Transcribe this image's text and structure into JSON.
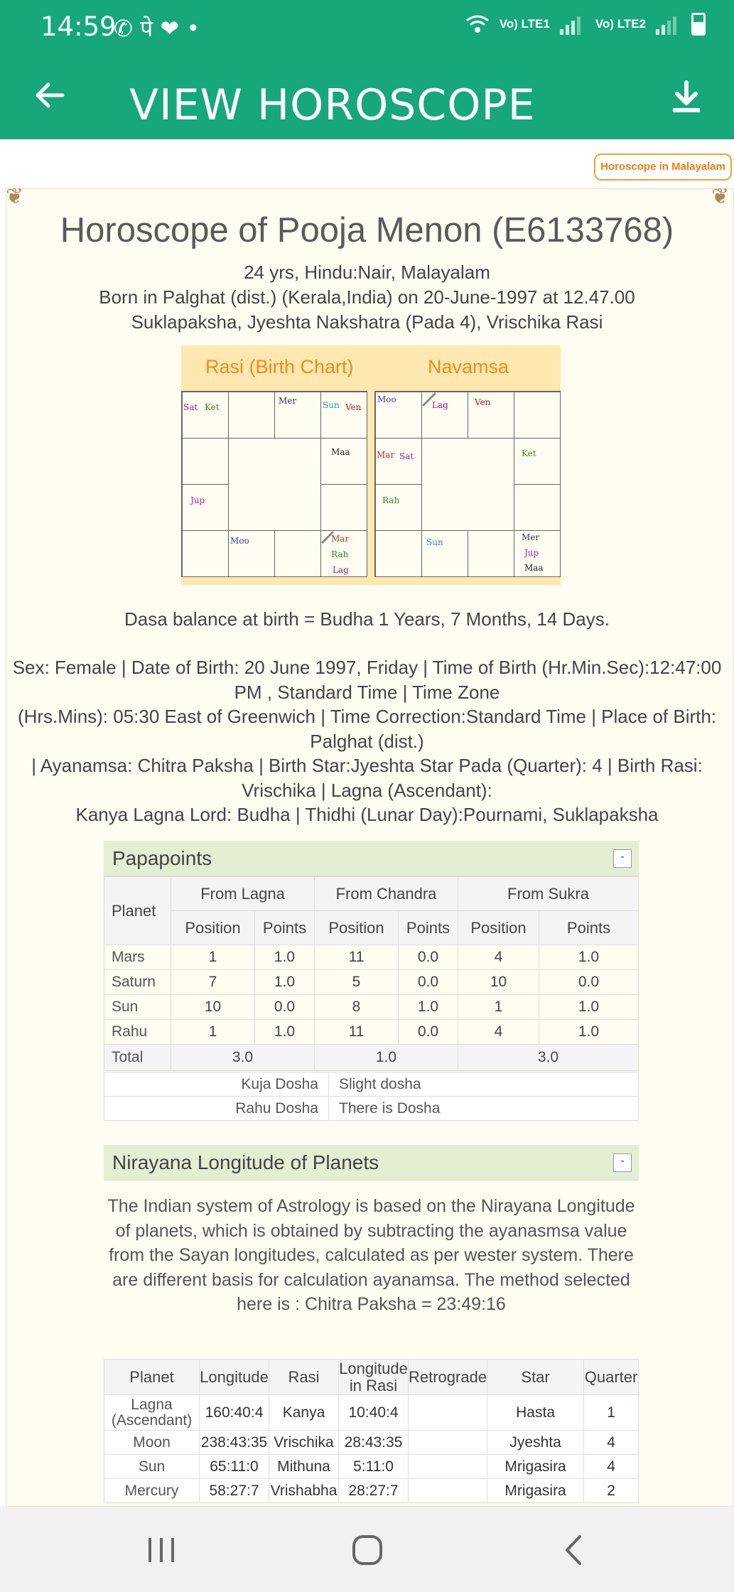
{
  "status_bar": {
    "time": "14:59",
    "notifications": "✆ पे ❤ •",
    "sim1": "Vo) LTE1",
    "sim2": "Vo) LTE2"
  },
  "app_bar": {
    "title": "VIEW HOROSCOPE"
  },
  "malayalam_button": "Horoscope in Malayalam",
  "header": {
    "title": "Horoscope of  Pooja Menon (E6133768)",
    "line1": "24 yrs, Hindu:Nair, Malayalam",
    "line2": "Born in Palghat (dist.) (Kerala,India) on 20-June-1997 at 12.47.00",
    "line3": "Suklapaksha, Jyeshta Nakshatra (Pada 4), Vrischika Rasi"
  },
  "charts": {
    "rasi_title": "Rasi (Birth Chart)",
    "navamsa_title": "Navamsa",
    "rasi": {
      "sat": "Sat",
      "ket": "Ket",
      "mer": "Mer",
      "sun": "Sun",
      "ven": "Ven",
      "maa": "Maa",
      "jup": "Jup",
      "moo": "Moo",
      "mar": "Mar",
      "rah": "Rah",
      "lag": "Lag"
    },
    "navamsa": {
      "moo": "Moo",
      "lag": "Lag",
      "ven": "Ven",
      "mar": "Mar",
      "sat": "Sat",
      "ket": "Ket",
      "rah": "Rah",
      "sun": "Sun",
      "mer": "Mer",
      "jup": "Jup",
      "maa": "Maa"
    }
  },
  "dasa": "Dasa balance at birth = Budha 1 Years, 7 Months, 14 Days.",
  "info_lines": [
    "Sex: Female | Date of Birth: 20 June 1997, Friday | Time of Birth (Hr.Min.Sec):12:47:00",
    "PM , Standard Time | Time Zone",
    "(Hrs.Mins): 05:30 East of Greenwich | Time Correction:Standard Time | Place of Birth:",
    "Palghat (dist.)",
    "| Ayanamsa: Chitra Paksha | Birth Star:Jyeshta Star Pada (Quarter): 4 | Birth Rasi:",
    "Vrischika | Lagna (Ascendant):",
    "Kanya Lagna Lord: Budha | Thidhi (Lunar Day):Pournami, Suklapaksha"
  ],
  "papapoints": {
    "title": "Papapoints",
    "collapse": "-",
    "headers": {
      "planet": "Planet",
      "from_lagna": "From Lagna",
      "from_chandra": "From Chandra",
      "from_sukra": "From Sukra",
      "position": "Position",
      "points": "Points"
    },
    "rows": [
      {
        "planet": "Mars",
        "lp": "1",
        "lpt": "1.0",
        "cp": "11",
        "cpt": "0.0",
        "sp": "4",
        "spt": "1.0"
      },
      {
        "planet": "Saturn",
        "lp": "7",
        "lpt": "1.0",
        "cp": "5",
        "cpt": "0.0",
        "sp": "10",
        "spt": "0.0"
      },
      {
        "planet": "Sun",
        "lp": "10",
        "lpt": "0.0",
        "cp": "8",
        "cpt": "1.0",
        "sp": "1",
        "spt": "1.0"
      },
      {
        "planet": "Rahu",
        "lp": "1",
        "lpt": "1.0",
        "cp": "11",
        "cpt": "0.0",
        "sp": "4",
        "spt": "1.0"
      }
    ],
    "total": {
      "label": "Total",
      "lagna": "3.0",
      "chandra": "1.0",
      "sukra": "3.0"
    },
    "dosha": [
      {
        "label": "Kuja Dosha",
        "value": "Slight dosha"
      },
      {
        "label": "Rahu Dosha",
        "value": "There is Dosha"
      }
    ]
  },
  "nirayana": {
    "title": "Nirayana Longitude of Planets",
    "collapse": "-",
    "description": "The Indian system of Astrology is based on the Nirayana Longitude of planets, which is obtained by subtracting the ayanasmsa value from the Sayan longitudes, calculated as per wester system. There are different basis for calculation ayanamsa. The method selected here is : Chitra Paksha = 23:49:16",
    "headers": {
      "planet": "Planet",
      "longitude": "Longitude",
      "rasi": "Rasi",
      "long_rasi_1": "Longitude",
      "long_rasi_2": "in Rasi",
      "retro": "Retrograde",
      "star": "Star",
      "quarter": "Quarter"
    },
    "rows": [
      {
        "planet1": "Lagna",
        "planet2": "(Ascendant)",
        "longitude": "160:40:4",
        "rasi": "Kanya",
        "lir": "10:40:4",
        "retro": "",
        "star": "Hasta",
        "quarter": "1"
      },
      {
        "planet1": "Moon",
        "planet2": "",
        "longitude": "238:43:35",
        "rasi": "Vrischika",
        "lir": "28:43:35",
        "retro": "",
        "star": "Jyeshta",
        "quarter": "4"
      },
      {
        "planet1": "Sun",
        "planet2": "",
        "longitude": "65:11:0",
        "rasi": "Mithuna",
        "lir": "5:11:0",
        "retro": "",
        "star": "Mrigasira",
        "quarter": "4"
      },
      {
        "planet1": "Mercury",
        "planet2": "",
        "longitude": "58:27:7",
        "rasi": "Vrishabha",
        "lir": "28:27:7",
        "retro": "",
        "star": "Mrigasira",
        "quarter": "2"
      }
    ]
  }
}
